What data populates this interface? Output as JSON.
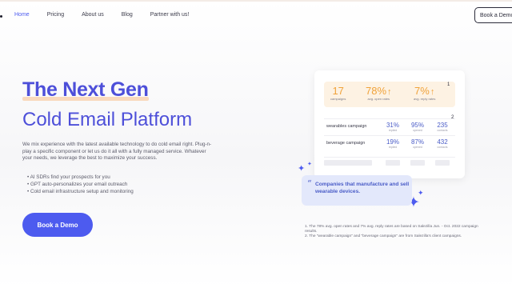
{
  "nav": {
    "items": [
      {
        "label": "Home",
        "active": true
      },
      {
        "label": "Pricing"
      },
      {
        "label": "About us"
      },
      {
        "label": "Blog"
      },
      {
        "label": "Partner with us!"
      }
    ],
    "book_demo_label": "Book a Demo"
  },
  "hero": {
    "title": "The Next Gen",
    "subtitle": "Cold Email Platform",
    "description": "We mix experience with the latest available technology to do cold email right. Plug-n-play a specific component or let us do it all with a fully managed service. Whatever your needs, we leverage the best to maximize your success.",
    "bullets": [
      "AI SDRs find your prospects for you",
      "GPT auto-personalizes your email outreach",
      "Cold email infrastructure setup and monitoring"
    ],
    "cta_label": "Book a Demo"
  },
  "card": {
    "stats": [
      {
        "value": "17",
        "label": "campaigns"
      },
      {
        "value": "78%",
        "label": "avg. open rates"
      },
      {
        "value": "7%",
        "label": "avg. reply rates"
      }
    ],
    "stats_footnote_mark": "1",
    "campaigns_footnote_mark": "2",
    "campaigns": [
      {
        "name": "wearables campaign",
        "open": "31%",
        "open_label": "replied",
        "positive": "95%",
        "positive_label": "opened",
        "contacts": "235",
        "contacts_label": "contacts"
      },
      {
        "name": "beverage campaign",
        "open": "19%",
        "open_label": "replied",
        "positive": "87%",
        "positive_label": "opened",
        "contacts": "432",
        "contacts_label": "contacts"
      }
    ]
  },
  "quote": {
    "mark": "“",
    "text": "Companies that manufacture and sell wearable devices."
  },
  "footnotes": {
    "note1": "1. The 78% avg. open rates and 7% avg. reply rates are based on Salezilla Jun. - Oct. 2022 campaign results.",
    "note2": "2. The \"wearable campaign\" and \"beverage campaign\" are from Salezilla's client campaigns."
  },
  "colors": {
    "accent": "#4d5bef",
    "title": "#4d4fd9",
    "stat_orange": "#f0a23a",
    "stat_bg": "#fdf2e3",
    "quote_bg": "#e3e8fb"
  },
  "icons": [
    "sparkle-icon",
    "up-arrow-icon",
    "quote-mark-icon"
  ]
}
